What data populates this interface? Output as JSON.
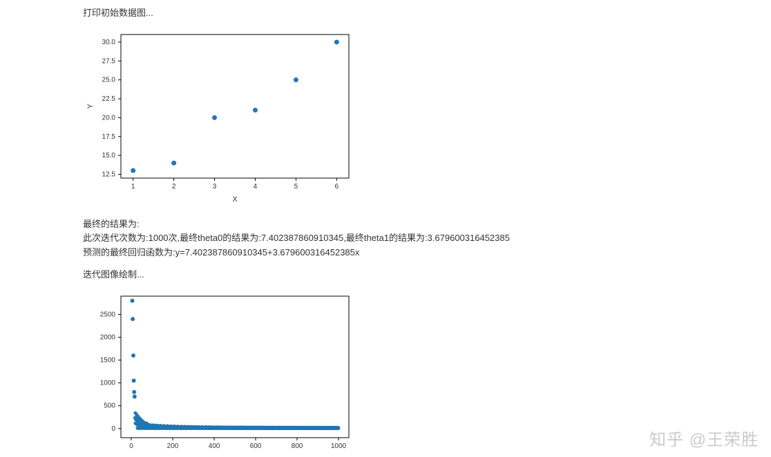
{
  "text": {
    "line1": "打印初始数据图...",
    "result_header": "最终的结果为:",
    "result_line1": "此次迭代次数为:1000次,最终theta0的结果为:7.402387860910345,最终theta1的结果为:3.679600316452385",
    "result_line2": "预测的最终回归函数为:y=7.402387860910345+3.679600316452385x",
    "iter_header": "迭代图像绘制..."
  },
  "watermark": "知乎 @王荣胜",
  "chart_data": [
    {
      "type": "scatter",
      "xlabel": "X",
      "ylabel": "Y",
      "x": [
        1,
        2,
        3,
        4,
        5,
        6
      ],
      "y": [
        13,
        14,
        20,
        21,
        25,
        30
      ],
      "xlim": [
        0.7,
        6.3
      ],
      "ylim": [
        12,
        31
      ],
      "xticks": [
        1,
        2,
        3,
        4,
        5,
        6
      ],
      "yticks": [
        12.5,
        15.0,
        17.5,
        20.0,
        22.5,
        25.0,
        27.5,
        30.0
      ]
    },
    {
      "type": "scatter",
      "xlabel": "",
      "ylabel": "",
      "x_range_note": "iterations 0-1000, cost decreasing",
      "xlim": [
        -50,
        1050
      ],
      "ylim": [
        -200,
        2900
      ],
      "xticks": [
        0,
        200,
        400,
        600,
        800,
        1000
      ],
      "yticks": [
        0,
        500,
        1000,
        1500,
        2000,
        2500
      ],
      "initial_points": [
        {
          "x": 5,
          "y": 2800
        },
        {
          "x": 7,
          "y": 2400
        },
        {
          "x": 10,
          "y": 1600
        },
        {
          "x": 12,
          "y": 1050
        },
        {
          "x": 14,
          "y": 800
        },
        {
          "x": 16,
          "y": 700
        }
      ]
    }
  ]
}
